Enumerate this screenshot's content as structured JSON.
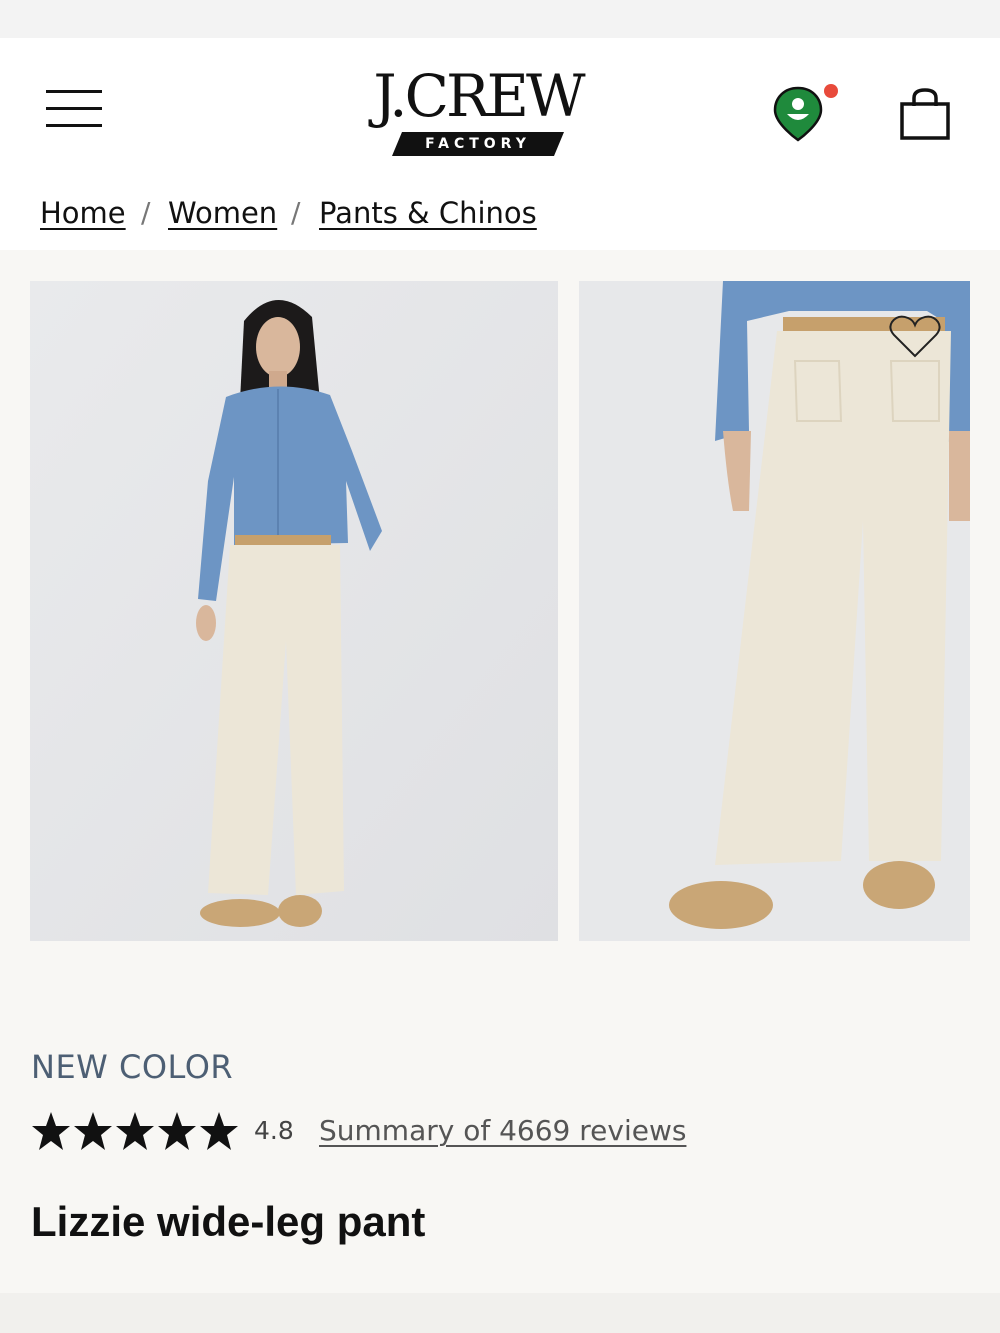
{
  "header": {
    "logo_text": "J.CREW",
    "logo_subtext": "FACTORY",
    "menu_icon": "hamburger-menu-icon",
    "store_icon": "store-locator-icon",
    "bag_icon": "shopping-bag-icon",
    "store_badge_color": "#e84a3b",
    "store_icon_color": "#1f8a3c"
  },
  "breadcrumb": {
    "items": [
      "Home",
      "Women",
      "Pants & Chinos"
    ],
    "separator": "/"
  },
  "gallery": {
    "images": [
      "front-view-photo",
      "close-up-photo"
    ],
    "wishlist_icon": "heart-icon"
  },
  "product": {
    "promo": "NEW COLOR",
    "rating": "4.8",
    "rating_stars": 5,
    "reviews_link": "Summary of 4669 reviews",
    "name": "Lizzie wide-leg pant"
  }
}
